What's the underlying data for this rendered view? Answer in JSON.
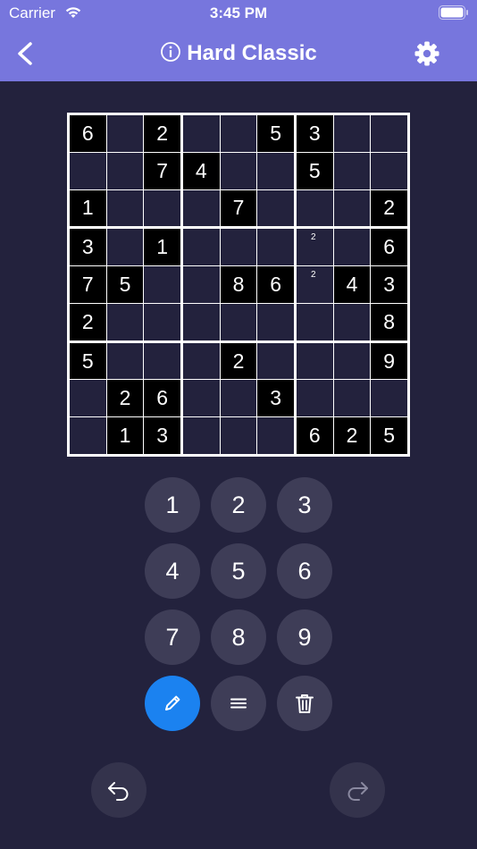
{
  "status": {
    "carrier": "Carrier",
    "time": "3:45 PM"
  },
  "header": {
    "title": "Hard Classic"
  },
  "grid": [
    [
      "6",
      "",
      "2",
      "",
      "",
      "5",
      "3",
      "",
      ""
    ],
    [
      "",
      "",
      "7",
      "4",
      "",
      "",
      "5",
      "",
      ""
    ],
    [
      "1",
      "",
      "",
      "",
      "7",
      "",
      "",
      "",
      "2"
    ],
    [
      "3",
      "",
      "1",
      "",
      "",
      "",
      "",
      "",
      "6"
    ],
    [
      "7",
      "5",
      "",
      "",
      "8",
      "6",
      "",
      "4",
      "3"
    ],
    [
      "2",
      "",
      "",
      "",
      "",
      "",
      "",
      "",
      "8"
    ],
    [
      "5",
      "",
      "",
      "",
      "2",
      "",
      "",
      "",
      "9"
    ],
    [
      "",
      "2",
      "6",
      "",
      "",
      "3",
      "",
      "",
      ""
    ],
    [
      "",
      "1",
      "3",
      "",
      "",
      "",
      "6",
      "2",
      "5"
    ]
  ],
  "givens": [
    [
      1,
      0,
      1,
      0,
      0,
      1,
      1,
      0,
      0
    ],
    [
      0,
      0,
      1,
      1,
      0,
      0,
      1,
      0,
      0
    ],
    [
      1,
      0,
      0,
      0,
      1,
      0,
      0,
      0,
      1
    ],
    [
      1,
      0,
      1,
      0,
      0,
      0,
      0,
      0,
      1
    ],
    [
      1,
      1,
      0,
      0,
      1,
      1,
      0,
      1,
      1
    ],
    [
      1,
      0,
      0,
      0,
      0,
      0,
      0,
      0,
      1
    ],
    [
      1,
      0,
      0,
      0,
      1,
      0,
      0,
      0,
      1
    ],
    [
      0,
      1,
      1,
      0,
      0,
      1,
      0,
      0,
      0
    ],
    [
      0,
      1,
      1,
      0,
      0,
      0,
      1,
      1,
      1
    ]
  ],
  "notes": [
    {
      "row": 3,
      "col": 6,
      "text": "2"
    },
    {
      "row": 4,
      "col": 6,
      "text": "2"
    }
  ],
  "keypad": {
    "numbers": [
      "1",
      "2",
      "3",
      "4",
      "5",
      "6",
      "7",
      "8",
      "9"
    ],
    "tools": [
      {
        "name": "pencil",
        "icon": "pencil-icon",
        "active": true
      },
      {
        "name": "menu",
        "icon": "lines-icon",
        "active": false
      },
      {
        "name": "erase",
        "icon": "trash-icon",
        "active": false
      }
    ]
  },
  "colors": {
    "header": "#7776dd",
    "background": "#23223d",
    "given_cell": "#000000",
    "active_tool": "#1b82f0"
  }
}
